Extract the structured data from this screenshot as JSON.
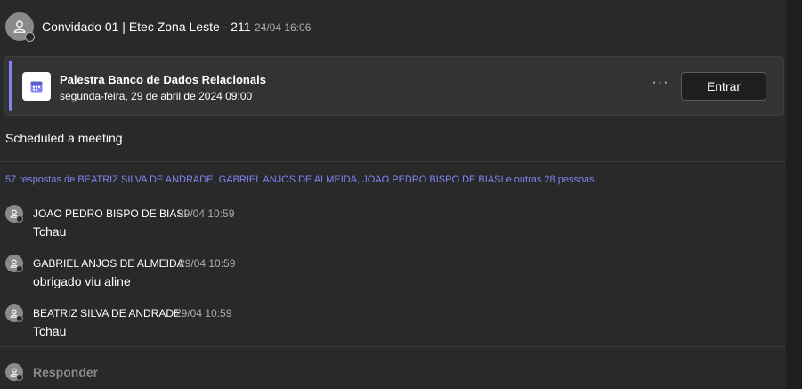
{
  "post": {
    "author": "Convidado 01 | Etec Zona Leste - 211",
    "timestamp": "24/04 16:06",
    "avatar_icon": "person-icon"
  },
  "meeting": {
    "title": "Palestra Banco de Dados Relacionais",
    "datetime": "segunda-feira, 29 de abril de 2024 09:00",
    "icon": "calendar-icon",
    "more_label": "···",
    "join_label": "Entrar"
  },
  "activity_text": "Scheduled a meeting",
  "replies": {
    "summary": "57 respostas de BEATRIZ SILVA DE ANDRADE, GABRIEL ANJOS DE ALMEIDA, JOAO PEDRO BISPO DE BIASI e outras 28 pessoas.",
    "items": [
      {
        "author": "JOAO PEDRO BISPO DE BIASI",
        "time": "29/04 10:59",
        "text": "Tchau"
      },
      {
        "author": "GABRIEL ANJOS DE ALMEIDA",
        "time": "29/04 10:59",
        "text": "obrigado viu aline"
      },
      {
        "author": "BEATRIZ SILVA DE ANDRADE",
        "time": "29/04 10:59",
        "text": "Tchau"
      }
    ]
  },
  "reply_box": {
    "placeholder": "Responder"
  },
  "colors": {
    "accent": "#7f85f5",
    "background": "#292929",
    "card": "#333333",
    "muted_text": "#adadad"
  }
}
